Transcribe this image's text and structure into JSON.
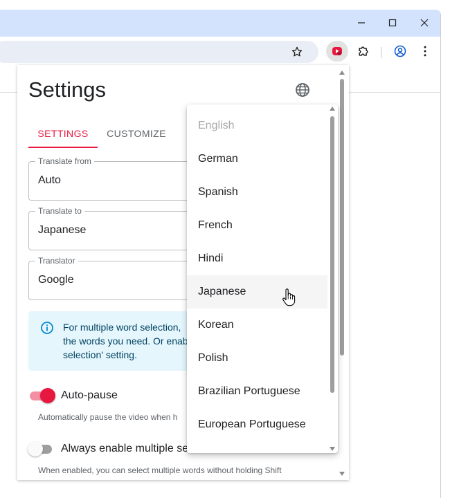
{
  "browser": {
    "window_controls": [
      "minimize",
      "maximize",
      "close"
    ],
    "toolbar_icons": [
      "bookmark-star-icon",
      "translator-extension-icon",
      "extensions-puzzle-icon",
      "profile-icon",
      "more-menu-icon"
    ]
  },
  "popup": {
    "title": "Settings",
    "tabs": [
      {
        "label": "SETTINGS",
        "active": true
      },
      {
        "label": "CUSTOMIZE",
        "active": false
      }
    ],
    "fields": {
      "translate_from": {
        "label": "Translate from",
        "value": "Auto"
      },
      "translate_to": {
        "label": "Translate to",
        "value": "Japanese"
      },
      "translator": {
        "label": "Translator",
        "value": "Google"
      }
    },
    "info": {
      "lines": [
        "For multiple word selection,",
        "the words you need. Or enab",
        "selection' setting."
      ]
    },
    "toggles": [
      {
        "label": "Auto-pause",
        "on": true,
        "description": "Automatically pause the video when h"
      },
      {
        "label": "Always enable multiple se",
        "on": false,
        "description": "When enabled, you can select multiple words without holding Shift"
      }
    ]
  },
  "dropdown": {
    "options": [
      {
        "label": "English",
        "disabled": true
      },
      {
        "label": "German"
      },
      {
        "label": "Spanish"
      },
      {
        "label": "French"
      },
      {
        "label": "Hindi"
      },
      {
        "label": "Japanese",
        "hovered": true
      },
      {
        "label": "Korean"
      },
      {
        "label": "Polish"
      },
      {
        "label": "Brazilian Portuguese"
      },
      {
        "label": "European Portuguese"
      }
    ]
  },
  "colors": {
    "accent": "#e8173f",
    "titlebar": "#d3e3fd",
    "info_background": "#e5f6fd",
    "info_icon": "#0288d1"
  }
}
